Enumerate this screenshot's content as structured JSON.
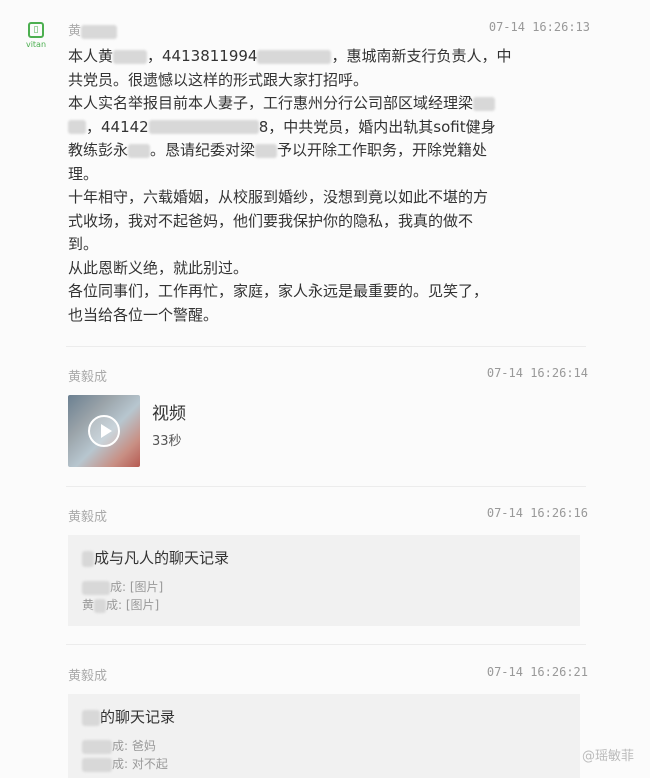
{
  "avatar": {
    "glyph": "▯",
    "caption": "vitan"
  },
  "messages": [
    {
      "sender": "黄",
      "time": "07-14 16:26:13",
      "lines": [
        "本人黄",
        "，4413811994",
        "，惠城南新支行负责人，中",
        "共党员。很遗憾以这样的形式跟大家打招呼。",
        "本人实名举报目前本人妻子，工行惠州分行公司部区域经理梁",
        "，44142",
        "8，中共党员，婚内出轨其sofit健身",
        "教练彭永",
        "。恳请纪委对梁",
        "予以开除工作职务，开除党籍处",
        "理。",
        "十年相守，六载婚姻，从校服到婚纱，没想到竟以如此不堪的方",
        "式收场，我对不起爸妈，他们要我保护你的隐私，我真的做不",
        "到。",
        "从此恩断义绝，就此别过。",
        "各位同事们，工作再忙，家庭，家人永远是最重要的。见笑了，",
        "也当给各位一个警醒。"
      ]
    },
    {
      "sender": "黄毅成",
      "time": "07-14 16:26:14",
      "video_title": "视频",
      "video_duration": "33秒"
    },
    {
      "sender": "黄毅成",
      "time": "07-14 16:26:16",
      "record_title": "成与凡人的聊天记录",
      "record_lines": [
        "成: [图片]",
        "黄",
        "成: [图片]"
      ]
    },
    {
      "sender": "黄毅成",
      "time": "07-14 16:26:21",
      "record_title": "的聊天记录",
      "record_lines": [
        "成: 爸妈",
        "成: 对不起"
      ]
    }
  ],
  "watermark": "@瑶敏菲"
}
